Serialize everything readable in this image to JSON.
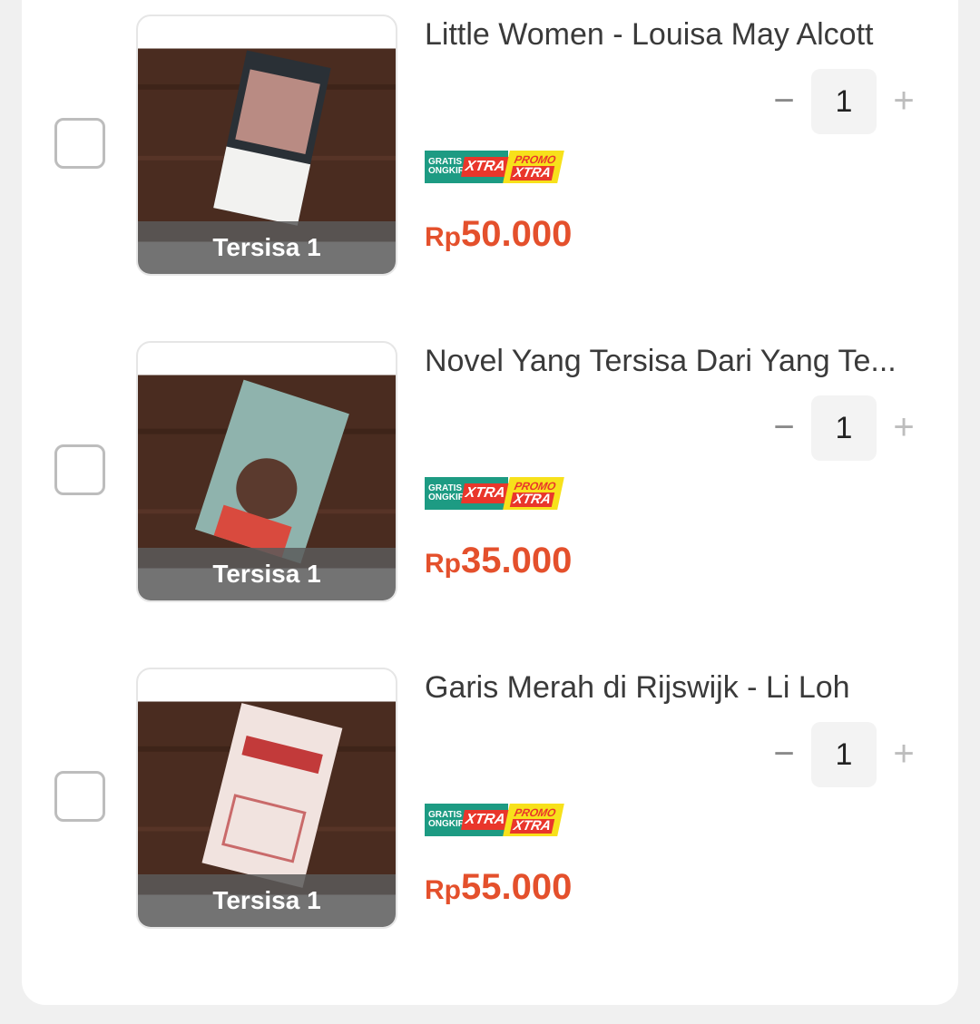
{
  "cart": {
    "items": [
      {
        "title": "Little Women - Louisa May Alcott",
        "stock_label": "Tersisa 1",
        "quantity": "1",
        "minus_label": "−",
        "plus_label": "+",
        "currency": "Rp",
        "price": "50.000",
        "badges": {
          "gratis_small": "GRATIS ONGKIR",
          "xtra": "XTRA",
          "promo_top": "PROMO",
          "promo_bottom": "XTRA"
        }
      },
      {
        "title": "Novel Yang Tersisa Dari Yang Te...",
        "stock_label": "Tersisa 1",
        "quantity": "1",
        "minus_label": "−",
        "plus_label": "+",
        "currency": "Rp",
        "price": "35.000",
        "badges": {
          "gratis_small": "GRATIS ONGKIR",
          "xtra": "XTRA",
          "promo_top": "PROMO",
          "promo_bottom": "XTRA"
        }
      },
      {
        "title": "Garis Merah di Rijswijk - Li Loh",
        "stock_label": "Tersisa 1",
        "quantity": "1",
        "minus_label": "−",
        "plus_label": "+",
        "currency": "Rp",
        "price": "55.000",
        "badges": {
          "gratis_small": "GRATIS ONGKIR",
          "xtra": "XTRA",
          "promo_top": "PROMO",
          "promo_bottom": "XTRA"
        }
      }
    ]
  },
  "colors": {
    "price": "#e4502c",
    "badge_green": "#1d9b83",
    "badge_yellow": "#f7e11b",
    "badge_red": "#e9362b"
  }
}
